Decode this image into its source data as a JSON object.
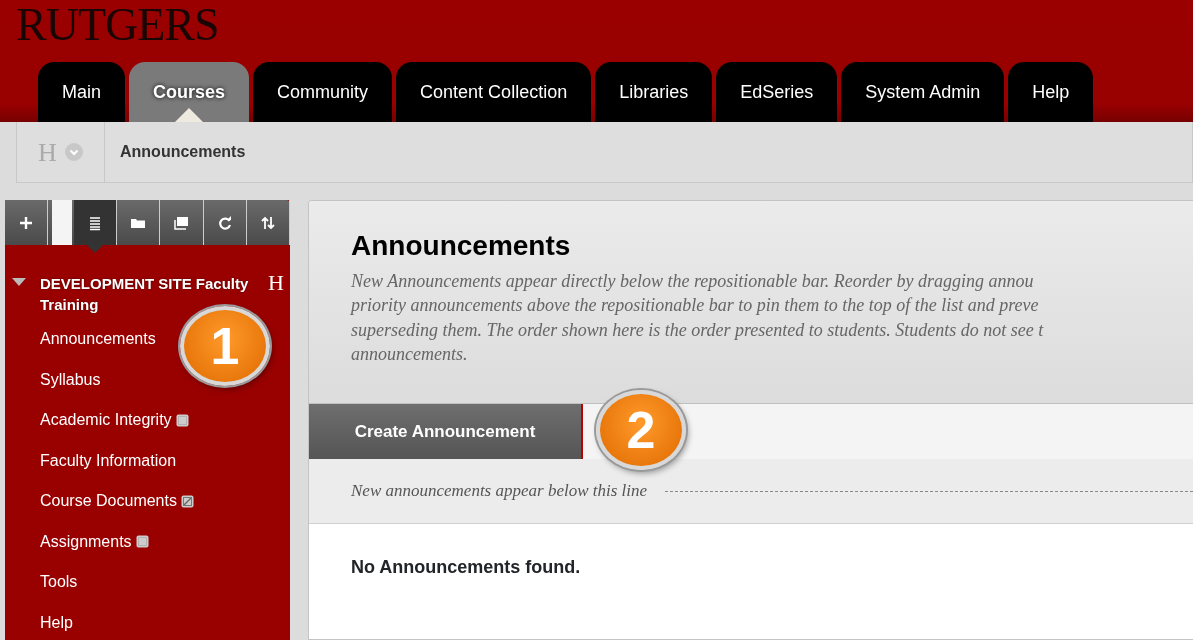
{
  "logo": "RUTGERS",
  "tabs": [
    {
      "label": "Main",
      "selected": false
    },
    {
      "label": "Courses",
      "selected": true
    },
    {
      "label": "Community",
      "selected": false
    },
    {
      "label": "Content Collection",
      "selected": false
    },
    {
      "label": "Libraries",
      "selected": false
    },
    {
      "label": "EdSeries",
      "selected": false
    },
    {
      "label": "System Admin",
      "selected": false
    },
    {
      "label": "Help",
      "selected": false
    }
  ],
  "breadcrumb": {
    "home_glyph": "H",
    "items": [
      "Announcements"
    ]
  },
  "sidebar": {
    "toolbar": [
      {
        "kind": "plus",
        "selected": false
      },
      {
        "kind": "blank",
        "selected": false
      },
      {
        "kind": "list",
        "selected": true
      },
      {
        "kind": "folder",
        "selected": false
      },
      {
        "kind": "windows",
        "selected": false
      },
      {
        "kind": "refresh",
        "selected": false
      },
      {
        "kind": "sort",
        "selected": false
      }
    ],
    "course": {
      "title": "DEVELOPMENT SITE Faculty Training",
      "glyph": "H",
      "expanded": true
    },
    "items": [
      {
        "label": "Announcements",
        "kind": "plain"
      },
      {
        "label": "Syllabus",
        "kind": "plain"
      },
      {
        "label": "Academic Integrity",
        "kind": "hidden"
      },
      {
        "label": "Faculty Information",
        "kind": "plain"
      },
      {
        "label": "Course Documents",
        "kind": "empty"
      },
      {
        "label": "Assignments",
        "kind": "hidden"
      },
      {
        "label": "Tools",
        "kind": "plain"
      },
      {
        "label": "Help",
        "kind": "plain"
      }
    ]
  },
  "main": {
    "title": "Announcements",
    "description": "New Announcements appear directly below the repositionable bar. Reorder by dragging annou\npriority announcements above the repositionable bar to pin them to the top of the list and preve\nsuperseding them. The order shown here is the order presented to students. Students do not see t\nannouncements.",
    "action_button": "Create Announcement",
    "divider_note": "New announcements appear below this line",
    "empty_message": "No Announcements found.",
    "callout": "2"
  },
  "sidebar_callout": "1"
}
